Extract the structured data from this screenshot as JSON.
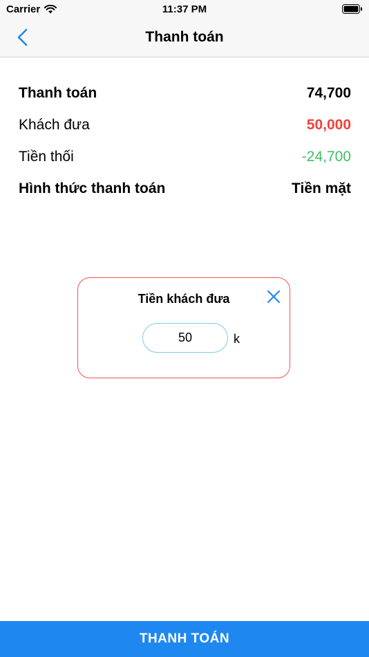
{
  "status_bar": {
    "carrier": "Carrier",
    "time": "11:37 PM"
  },
  "nav": {
    "title": "Thanh toán"
  },
  "summary": {
    "total_label": "Thanh toán",
    "total_value": "74,700",
    "given_label": "Khách đưa",
    "given_value": "50,000",
    "change_label": "Tiền thối",
    "change_value": "-24,700",
    "method_label": "Hình thức thanh toán",
    "method_value": "Tiền mặt"
  },
  "dialog": {
    "title": "Tiền khách đưa",
    "amount_value": "50",
    "unit": "k"
  },
  "footer": {
    "pay_label": "THANH TOÁN"
  },
  "colors": {
    "accent": "#1e88f0",
    "negative": "#ef4236",
    "positive": "#3cbf62",
    "dialog_border": "#ef5350"
  }
}
